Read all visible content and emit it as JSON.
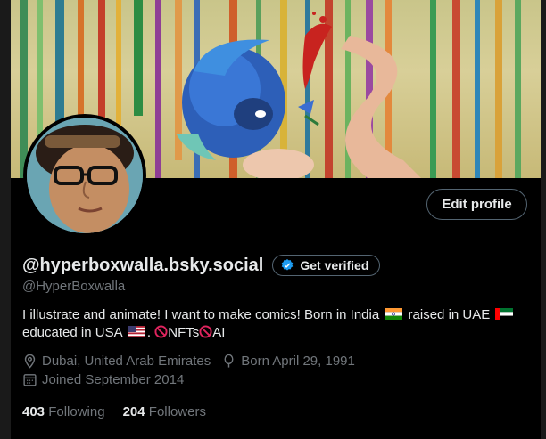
{
  "profile": {
    "display_name": "@hyperboxwalla.bsky.social",
    "handle": "@HyperBoxwalla",
    "bio": {
      "part1": "I illustrate and animate! I want to make comics! Born in India",
      "part2": "raised in UAE",
      "part3": "educated in USA",
      "part4": ".",
      "nfts": "NFTs",
      "ai": "AI"
    },
    "location": "Dubai, United Arab Emirates",
    "birthday": "Born April 29, 1991",
    "joined": "Joined September 2014",
    "following_count": "403",
    "following_label": "Following",
    "followers_count": "204",
    "followers_label": "Followers"
  },
  "actions": {
    "edit_profile": "Edit profile",
    "get_verified": "Get verified"
  },
  "colors": {
    "background": "#000000",
    "text_primary": "#e7e9ea",
    "text_secondary": "#71767b",
    "border": "#536471",
    "verified_blue": "#1d9bf0"
  },
  "icons": {
    "location": "location-pin-icon",
    "birthday": "balloon-icon",
    "joined": "calendar-icon",
    "verified": "verified-badge-icon"
  }
}
